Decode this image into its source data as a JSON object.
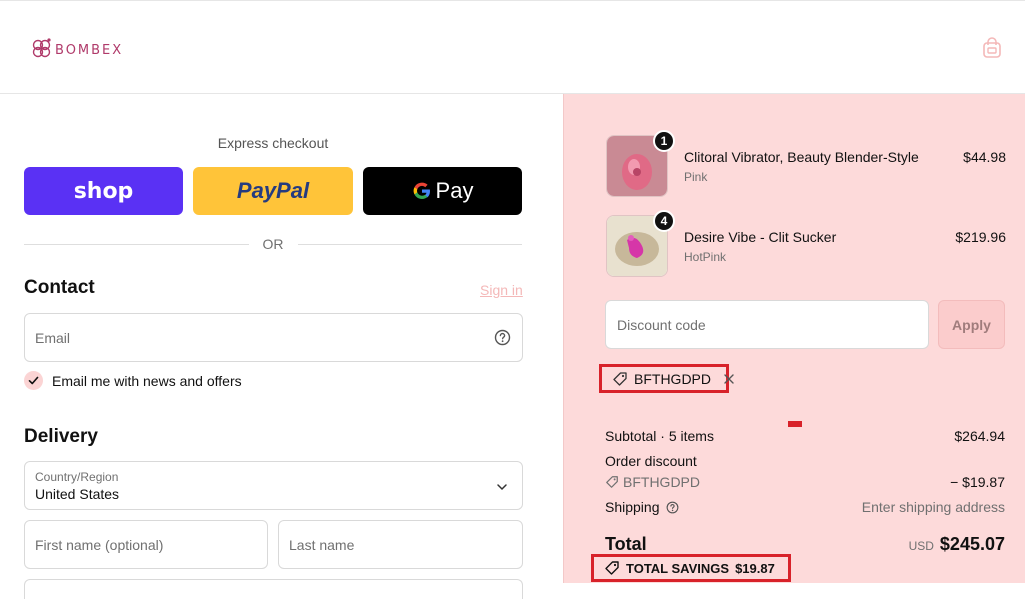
{
  "header": {
    "brand": "BOMBEX",
    "icons": {
      "logo": "flower-logo-icon",
      "cart": "shopping-bag-icon"
    }
  },
  "express": {
    "title": "Express checkout",
    "shop_label": "shop",
    "paypal_label": "PayPal",
    "gpay_label": "Pay",
    "or_label": "OR"
  },
  "contact": {
    "heading": "Contact",
    "signin": "Sign in",
    "email_placeholder": "Email",
    "news_label": "Email me with news and offers"
  },
  "delivery": {
    "heading": "Delivery",
    "country_label": "Country/Region",
    "country_value": "United States",
    "first_name_placeholder": "First name (optional)",
    "last_name_placeholder": "Last name"
  },
  "cart": {
    "items": [
      {
        "qty": "1",
        "name": "Clitoral Vibrator, Beauty Blender-Style",
        "variant": "Pink",
        "price": "$44.98"
      },
      {
        "qty": "4",
        "name": "Desire Vibe - Clit Sucker",
        "variant": "HotPink",
        "price": "$219.96"
      }
    ],
    "discount_placeholder": "Discount code",
    "apply_label": "Apply",
    "applied_code": "BFTHGDPD"
  },
  "summary": {
    "subtotal_label": "Subtotal · 5 items",
    "subtotal_value": "$264.94",
    "order_discount_label": "Order discount",
    "discount_code": "BFTHGDPD",
    "discount_value": "− $19.87",
    "shipping_label": "Shipping",
    "shipping_value": "Enter shipping address",
    "total_label": "Total",
    "currency": "USD",
    "total_value": "$245.07",
    "savings_label": "TOTAL SAVINGS",
    "savings_value": "$19.87"
  },
  "colors": {
    "accent_pink": "#fddada",
    "highlight_red": "#d8222a",
    "shop_purple": "#5a31f4",
    "paypal_yellow": "#ffc439"
  }
}
